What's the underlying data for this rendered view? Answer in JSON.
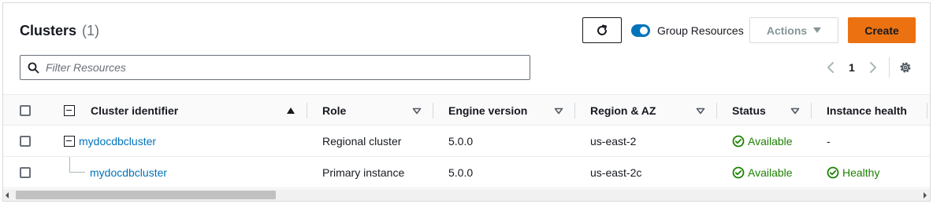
{
  "header": {
    "title": "Clusters",
    "count": "(1)",
    "group_resources_label": "Group Resources",
    "group_resources_on": true,
    "actions_label": "Actions",
    "create_label": "Create"
  },
  "filter": {
    "placeholder": "Filter Resources",
    "value": ""
  },
  "pagination": {
    "current_page": "1"
  },
  "table": {
    "columns": [
      {
        "label": "Cluster identifier",
        "sort": "ascending"
      },
      {
        "label": "Role",
        "sort": "none"
      },
      {
        "label": "Engine version",
        "sort": "none"
      },
      {
        "label": "Region & AZ",
        "sort": "none"
      },
      {
        "label": "Status",
        "sort": "none"
      },
      {
        "label": "Instance health",
        "sort": "none"
      }
    ],
    "rows": [
      {
        "identifier": "mydocdbcluster",
        "role": "Regional cluster",
        "engine": "5.0.0",
        "region": "us-east-2",
        "status": "Available",
        "health": "-"
      },
      {
        "identifier": "mydocdbcluster",
        "role": "Primary instance",
        "engine": "5.0.0",
        "region": "us-east-2c",
        "status": "Available",
        "health": "Healthy"
      }
    ]
  },
  "colors": {
    "accent": "#0073bb",
    "create": "#ec7211",
    "success": "#1d8102"
  }
}
